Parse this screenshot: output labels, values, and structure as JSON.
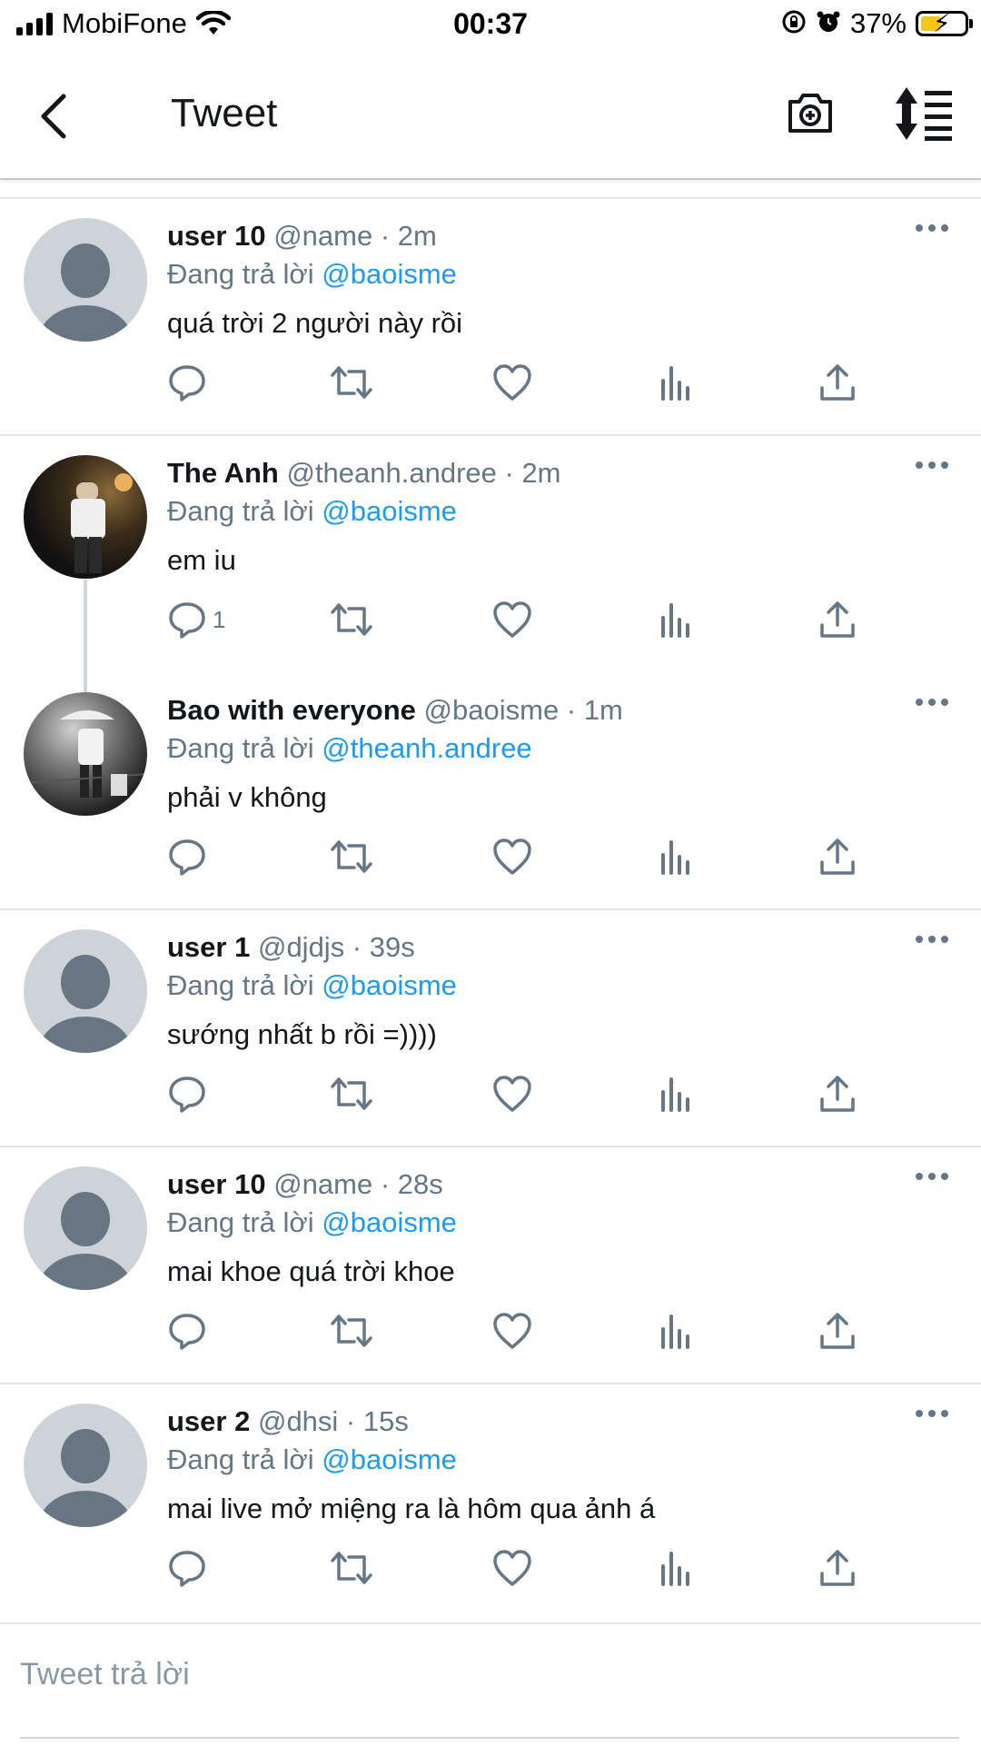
{
  "status_bar": {
    "carrier": "MobiFone",
    "time": "00:37",
    "battery_percent": "37%",
    "battery_level": 0.37
  },
  "header": {
    "title": "Tweet"
  },
  "replying_label": "Đang trả lời",
  "tweets": [
    {
      "name": "user 10",
      "handle": "@name · 2m",
      "reply_to": "@baoisme",
      "text": "quá trời 2 người này rồi",
      "reply_count": "",
      "avatar": "default-avatar"
    },
    {
      "name": "The Anh",
      "handle": "@theanh.andree · 2m",
      "reply_to": "@baoisme",
      "text": "em iu",
      "reply_count": "1",
      "avatar": "photo-avatar"
    },
    {
      "name": "Bao with everyone",
      "handle": "@baoisme · 1m",
      "reply_to": "@theanh.andree",
      "text": "phải v không",
      "reply_count": "",
      "avatar": "photo-avatar"
    },
    {
      "name": "user 1",
      "handle": "@djdjs · 39s",
      "reply_to": "@baoisme",
      "text": "sướng nhất b rồi =))))",
      "reply_count": "",
      "avatar": "default-avatar"
    },
    {
      "name": "user 10",
      "handle": "@name · 28s",
      "reply_to": "@baoisme",
      "text": "mai khoe quá trời khoe",
      "reply_count": "",
      "avatar": "default-avatar"
    },
    {
      "name": "user 2",
      "handle": "@dhsi · 15s",
      "reply_to": "@baoisme",
      "text": "mai live mở miệng ra là hôm qua ảnh á",
      "reply_count": "",
      "avatar": "default-avatar"
    }
  ],
  "compose": {
    "placeholder": "Tweet trả lời"
  },
  "colors": {
    "accent": "#1d9bf0",
    "secondary_text": "#657786",
    "icon": "#657786",
    "divider": "#e3e6e8"
  }
}
